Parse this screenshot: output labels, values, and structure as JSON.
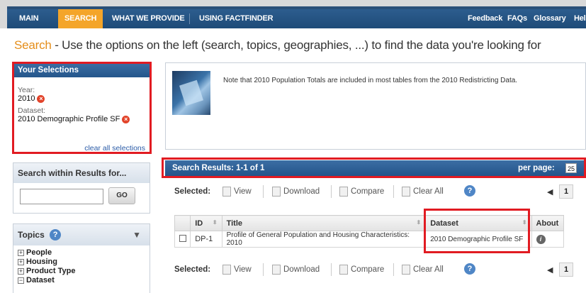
{
  "nav": {
    "main": "MAIN",
    "search": "SEARCH",
    "what_we_provide": "WHAT WE PROVIDE",
    "using_factfinder": "USING FACTFINDER",
    "feedback": "Feedback",
    "faqs": "FAQs",
    "glossary": "Glossary",
    "help": "Hel"
  },
  "page": {
    "title_word": "Search",
    "title_rest": " - Use the options on the left (search, topics, geographies, ...) to find the data you're looking for"
  },
  "selections": {
    "heading": "Your Selections",
    "year_label": "Year:",
    "year_value": "2010",
    "dataset_label": "Dataset:",
    "dataset_value": "2010 Demographic Profile SF",
    "clear_all": "clear all selections"
  },
  "search_within": {
    "heading": "Search within Results for...",
    "input_value": "",
    "go_label": "GO"
  },
  "topics": {
    "heading": "Topics",
    "items": [
      {
        "sign": "+",
        "label": "People"
      },
      {
        "sign": "+",
        "label": "Housing"
      },
      {
        "sign": "+",
        "label": "Product Type"
      },
      {
        "sign": "−",
        "label": "Dataset"
      }
    ]
  },
  "notice": {
    "text": "Note that 2010 Population Totals are included in most tables from the 2010 Redistricting Data."
  },
  "results": {
    "summary": "Search Results:  1-1  of  1",
    "per_page_label": "per page:",
    "per_page_value": "25",
    "toolbar": {
      "selected": "Selected:",
      "view": "View",
      "download": "Download",
      "compare": "Compare",
      "clear_all": "Clear All",
      "help": "?"
    },
    "columns": [
      "ID",
      "Title",
      "Dataset",
      "About"
    ],
    "rows": [
      {
        "id": "DP-1",
        "title": "Profile of General Population and Housing Characteristics: 2010",
        "dataset": "2010 Demographic Profile SF",
        "about": "i"
      }
    ],
    "pager": {
      "current": "1",
      "prev": "◀"
    }
  },
  "colors": {
    "nav_blue": "#1e4b78",
    "nav_active": "#f4a52a",
    "highlight_red": "#e11b22",
    "link_blue": "#2a5ba7"
  }
}
